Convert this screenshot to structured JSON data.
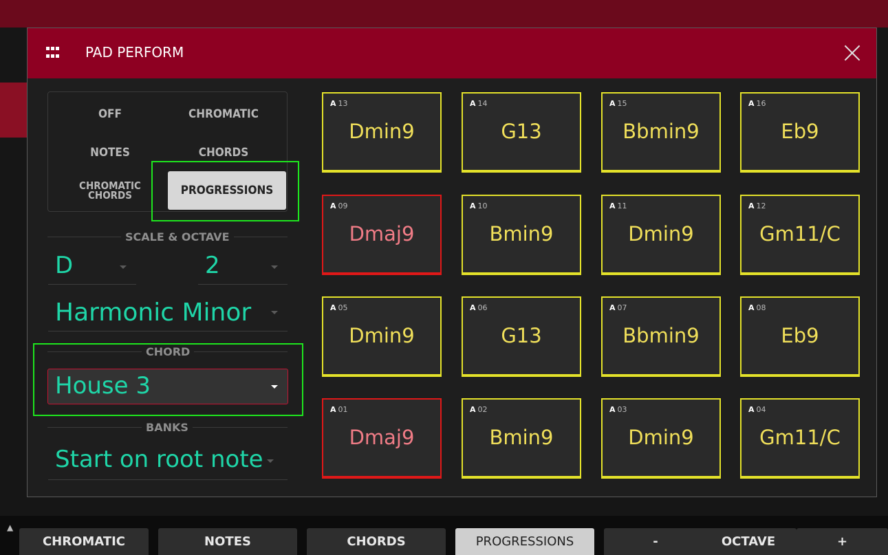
{
  "modal": {
    "title": "PAD PERFORM",
    "icons": {
      "grid": "grid-icon",
      "close": "close-icon"
    }
  },
  "modes": {
    "off": "OFF",
    "chromatic": "CHROMATIC",
    "notes": "NOTES",
    "chords": "CHORDS",
    "chromatic_chords_line1": "CHROMATIC",
    "chromatic_chords_line2": "CHORDS",
    "progressions": "PROGRESSIONS",
    "selected": "PROGRESSIONS"
  },
  "scale_octave": {
    "label": "SCALE & OCTAVE",
    "root": "D",
    "octave": "2",
    "scale": "Harmonic Minor"
  },
  "chord": {
    "label": "CHORD",
    "value": "House 3"
  },
  "banks": {
    "label": "BANKS",
    "value": "Start on root note"
  },
  "pads": [
    {
      "bank": "A",
      "num": "13",
      "chord": "Dmin9",
      "state": "normal"
    },
    {
      "bank": "A",
      "num": "14",
      "chord": "G13",
      "state": "normal"
    },
    {
      "bank": "A",
      "num": "15",
      "chord": "Bbmin9",
      "state": "normal"
    },
    {
      "bank": "A",
      "num": "16",
      "chord": "Eb9",
      "state": "normal"
    },
    {
      "bank": "A",
      "num": "09",
      "chord": "Dmaj9",
      "state": "root"
    },
    {
      "bank": "A",
      "num": "10",
      "chord": "Bmin9",
      "state": "normal"
    },
    {
      "bank": "A",
      "num": "11",
      "chord": "Dmin9",
      "state": "normal"
    },
    {
      "bank": "A",
      "num": "12",
      "chord": "Gm11/C",
      "state": "normal"
    },
    {
      "bank": "A",
      "num": "05",
      "chord": "Dmin9",
      "state": "normal"
    },
    {
      "bank": "A",
      "num": "06",
      "chord": "G13",
      "state": "normal"
    },
    {
      "bank": "A",
      "num": "07",
      "chord": "Bbmin9",
      "state": "normal"
    },
    {
      "bank": "A",
      "num": "08",
      "chord": "Eb9",
      "state": "normal"
    },
    {
      "bank": "A",
      "num": "01",
      "chord": "Dmaj9",
      "state": "root"
    },
    {
      "bank": "A",
      "num": "02",
      "chord": "Bmin9",
      "state": "normal"
    },
    {
      "bank": "A",
      "num": "03",
      "chord": "Dmin9",
      "state": "normal"
    },
    {
      "bank": "A",
      "num": "04",
      "chord": "Gm11/C",
      "state": "normal"
    }
  ],
  "bottom_tabs": {
    "chromatic": "CHROMATIC",
    "notes": "NOTES",
    "chords": "CHORDS",
    "progressions": "PROGRESSIONS",
    "octave_minus": "-",
    "octave_label": "OCTAVE",
    "octave_plus": "+",
    "active": "PROGRESSIONS"
  },
  "colors": {
    "header": "#8e0022",
    "accent_teal": "#1fd6a8",
    "pad_yellow": "#e4e22a",
    "pad_red": "#e01818",
    "highlight_green": "#1ee61e"
  }
}
